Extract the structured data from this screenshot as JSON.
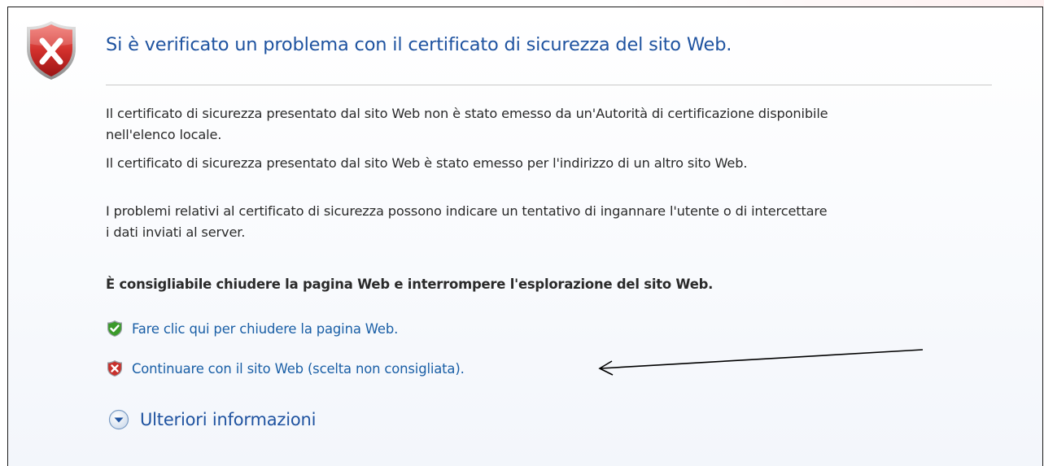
{
  "page": {
    "title": "Si è verificato un problema con il certificato di sicurezza del sito Web.",
    "paragraph_1_line_1": "Il certificato di sicurezza presentato dal sito Web non è stato emesso da un'Autorità di certificazione disponibile",
    "paragraph_1_line_2": "nell'elenco locale.",
    "paragraph_2": "Il certificato di sicurezza presentato dal sito Web è stato emesso per l'indirizzo di un altro sito Web.",
    "paragraph_3_line_1": "I problemi relativi al certificato di sicurezza possono indicare un tentativo di ingannare l'utente o di intercettare",
    "paragraph_3_line_2": "i dati inviati al server.",
    "recommendation": "È consigliabile chiudere la pagina Web e interrompere l'esplorazione del sito Web."
  },
  "links": {
    "close_page": "Fare clic qui per chiudere la pagina Web.",
    "continue_site": "Continuare con il sito Web (scelta non consigliata).",
    "more_info": "Ulteriori informazioni"
  },
  "icons": {
    "header": "error-shield-icon",
    "close": "green-check-shield-icon",
    "continue": "red-x-shield-icon",
    "more": "expand-chevron-icon",
    "annotation": "pointer-arrow"
  },
  "colors": {
    "title": "#1f53a0",
    "link": "#1a5fa6",
    "text": "#2a2a2a",
    "error": "#c0282a",
    "safe": "#3a9a2a"
  }
}
